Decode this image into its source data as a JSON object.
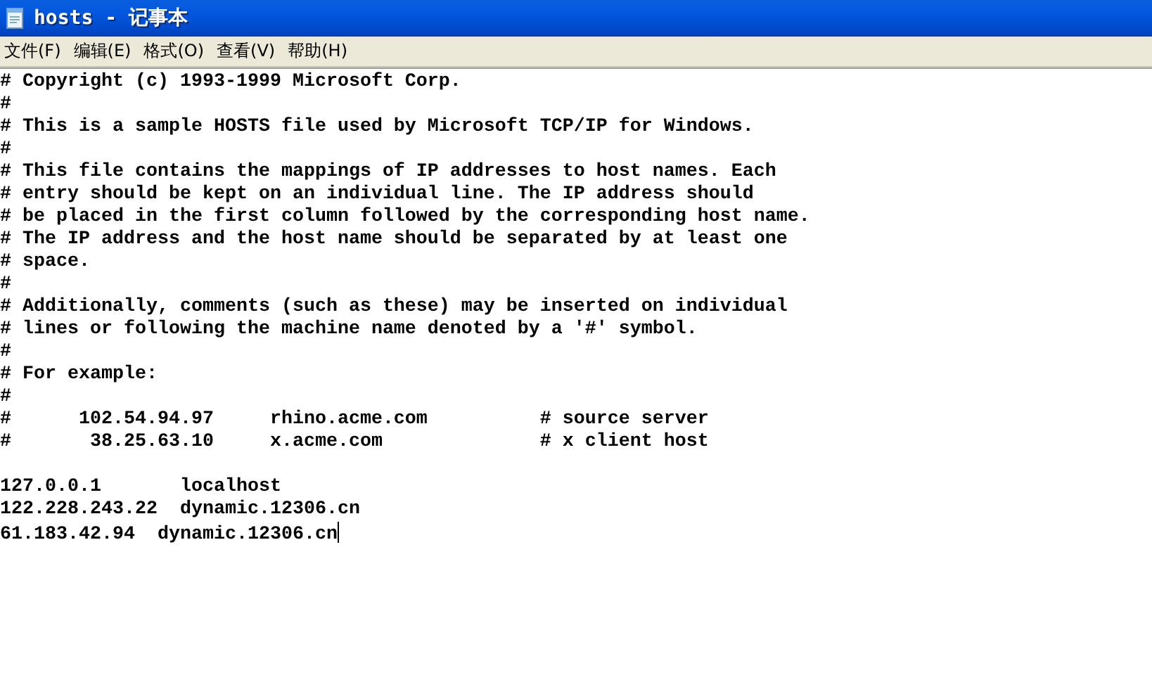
{
  "window": {
    "title": "hosts - 记事本"
  },
  "menu": [
    {
      "label": "文件(F)"
    },
    {
      "label": "编辑(E)"
    },
    {
      "label": "格式(O)"
    },
    {
      "label": "查看(V)"
    },
    {
      "label": "帮助(H)"
    }
  ],
  "editor": {
    "comment_lines": [
      "# Copyright (c) 1993-1999 Microsoft Corp.",
      "#",
      "# This is a sample HOSTS file used by Microsoft TCP/IP for Windows.",
      "#",
      "# This file contains the mappings of IP addresses to host names. Each",
      "# entry should be kept on an individual line. The IP address should",
      "# be placed in the first column followed by the corresponding host name.",
      "# The IP address and the host name should be separated by at least one",
      "# space.",
      "#",
      "# Additionally, comments (such as these) may be inserted on individual",
      "# lines or following the machine name denoted by a '#' symbol.",
      "#",
      "# For example:",
      "#",
      "#      102.54.94.97     rhino.acme.com          # source server",
      "#       38.25.63.10     x.acme.com              # x client host"
    ],
    "host_lines": [
      "127.0.0.1       localhost",
      "122.228.243.22  dynamic.12306.cn",
      "61.183.42.94  dynamic.12306.cn"
    ],
    "caret_at_end": true
  }
}
